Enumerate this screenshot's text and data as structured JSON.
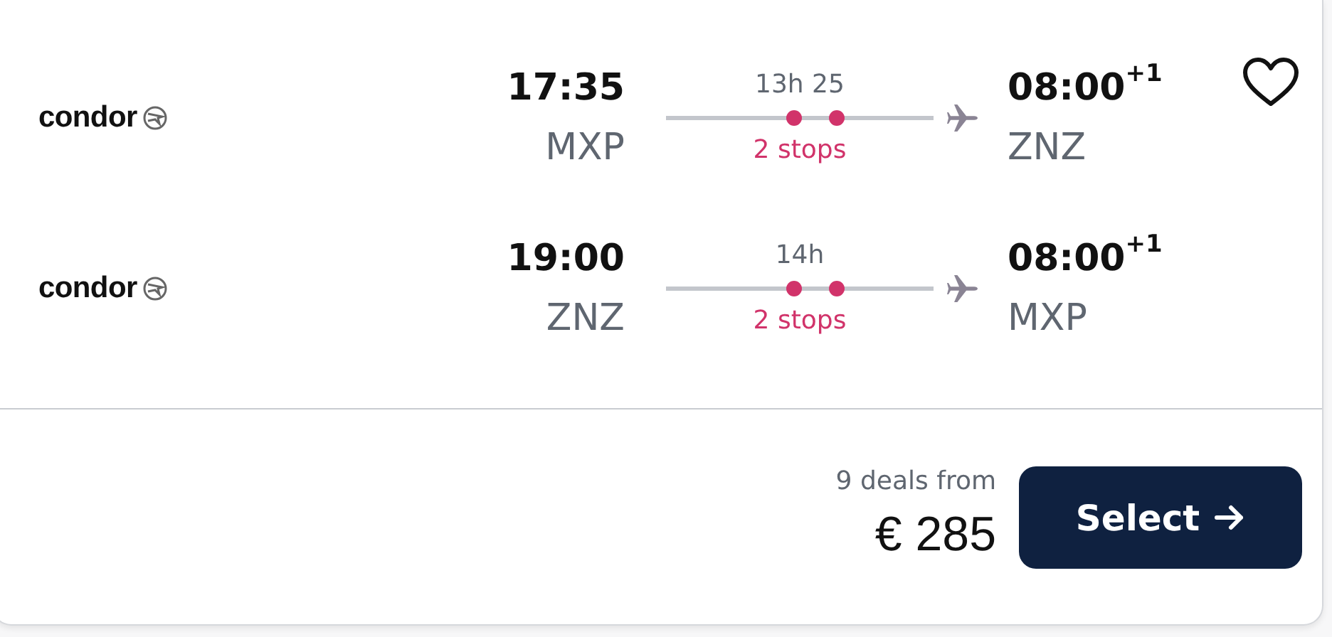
{
  "legs": [
    {
      "airline": "condor",
      "depart_time": "17:35",
      "depart_code": "MXP",
      "duration": "13h 25",
      "stops": "2 stops",
      "arrive_time": "08:00",
      "day_offset": "+1",
      "arrive_code": "ZNZ"
    },
    {
      "airline": "condor",
      "depart_time": "19:00",
      "depart_code": "ZNZ",
      "duration": "14h",
      "stops": "2 stops",
      "arrive_time": "08:00",
      "day_offset": "+1",
      "arrive_code": "MXP"
    }
  ],
  "favorite": {
    "selected": false
  },
  "deals": "9 deals from",
  "price": "€ 285",
  "select_button": "Select"
}
